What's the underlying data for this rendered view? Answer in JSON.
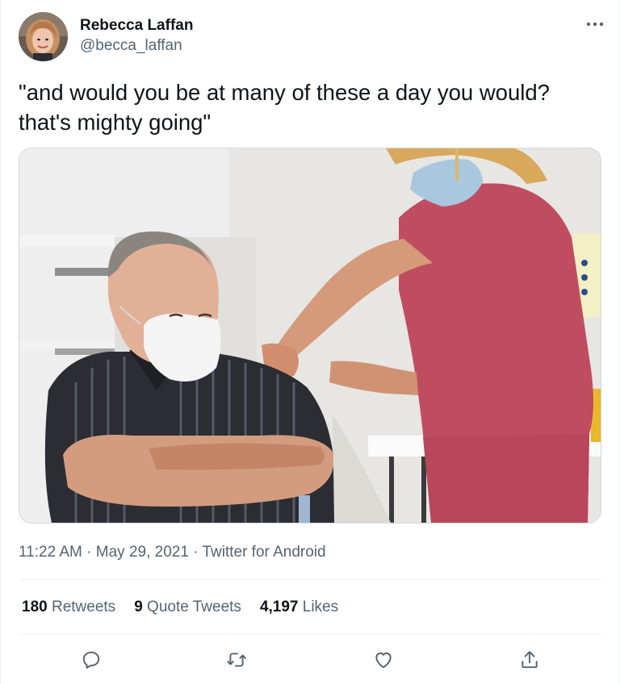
{
  "tweet": {
    "author": {
      "display_name": "Rebecca Laffan",
      "handle": "@becca_laffan"
    },
    "more_icon": "more-horizontal-icon",
    "text": "\"and would you be at many of these a day you would?\nthat's mighty going\"",
    "media": {
      "icon": "photo-man-in-striped-shirt-with-nurse-vaccinating"
    },
    "meta": {
      "time": "11:22 AM",
      "separator": " · ",
      "date": "May 29, 2021",
      "source": "Twitter for Android"
    },
    "stats": {
      "retweets": {
        "count": "180",
        "label": "Retweets"
      },
      "quotes": {
        "count": "9",
        "label": "Quote Tweets"
      },
      "likes": {
        "count": "4,197",
        "label": "Likes"
      }
    },
    "actions": {
      "reply": "reply-icon",
      "retweet": "retweet-icon",
      "like": "heart-icon",
      "share": "share-icon"
    },
    "colors": {
      "text_primary": "#0f1419",
      "text_secondary": "#536471",
      "icon": "#536471",
      "divider": "#eff3f4"
    }
  }
}
